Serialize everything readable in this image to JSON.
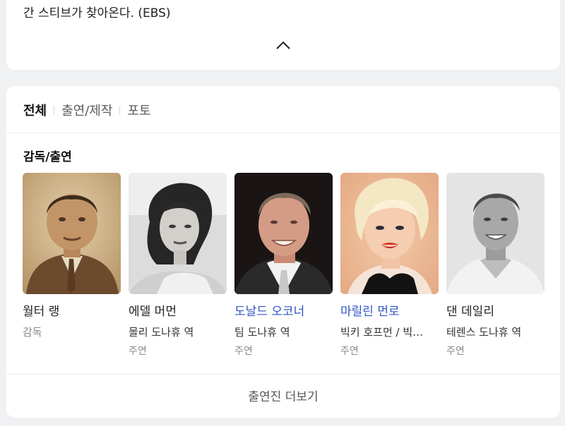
{
  "top_card": {
    "text": "간 스티브가 찾아온다. (EBS)",
    "collapse_icon": "chevron-up-icon"
  },
  "tabs": [
    {
      "label": "전체",
      "active": true
    },
    {
      "label": "출연/제작",
      "active": false
    },
    {
      "label": "포토",
      "active": false
    }
  ],
  "section": {
    "title": "감독/출연"
  },
  "people": [
    {
      "name": "월터 랭",
      "name_link": false,
      "dept": "감독",
      "photo": "sepia-portrait"
    },
    {
      "name": "에델 머먼",
      "name_link": false,
      "role": "몰리 도나휴 역",
      "type": "주연",
      "photo": "bw-portrait"
    },
    {
      "name": "도날드 오코너",
      "name_link": true,
      "role": "팀 도나휴 역",
      "type": "주연",
      "photo": "color-portrait"
    },
    {
      "name": "마릴린 먼로",
      "name_link": true,
      "role": "빅키 호프먼 / 빅…",
      "type": "주연",
      "photo": "color-portrait"
    },
    {
      "name": "댄 데일리",
      "name_link": false,
      "role": "테렌스 도나휴 역",
      "type": "주연",
      "photo": "bw-portrait"
    }
  ],
  "more_button": {
    "label": "출연진 더보기"
  },
  "colors": {
    "link": "#2f56c4",
    "background": "#f0f1f3",
    "card": "#ffffff"
  }
}
